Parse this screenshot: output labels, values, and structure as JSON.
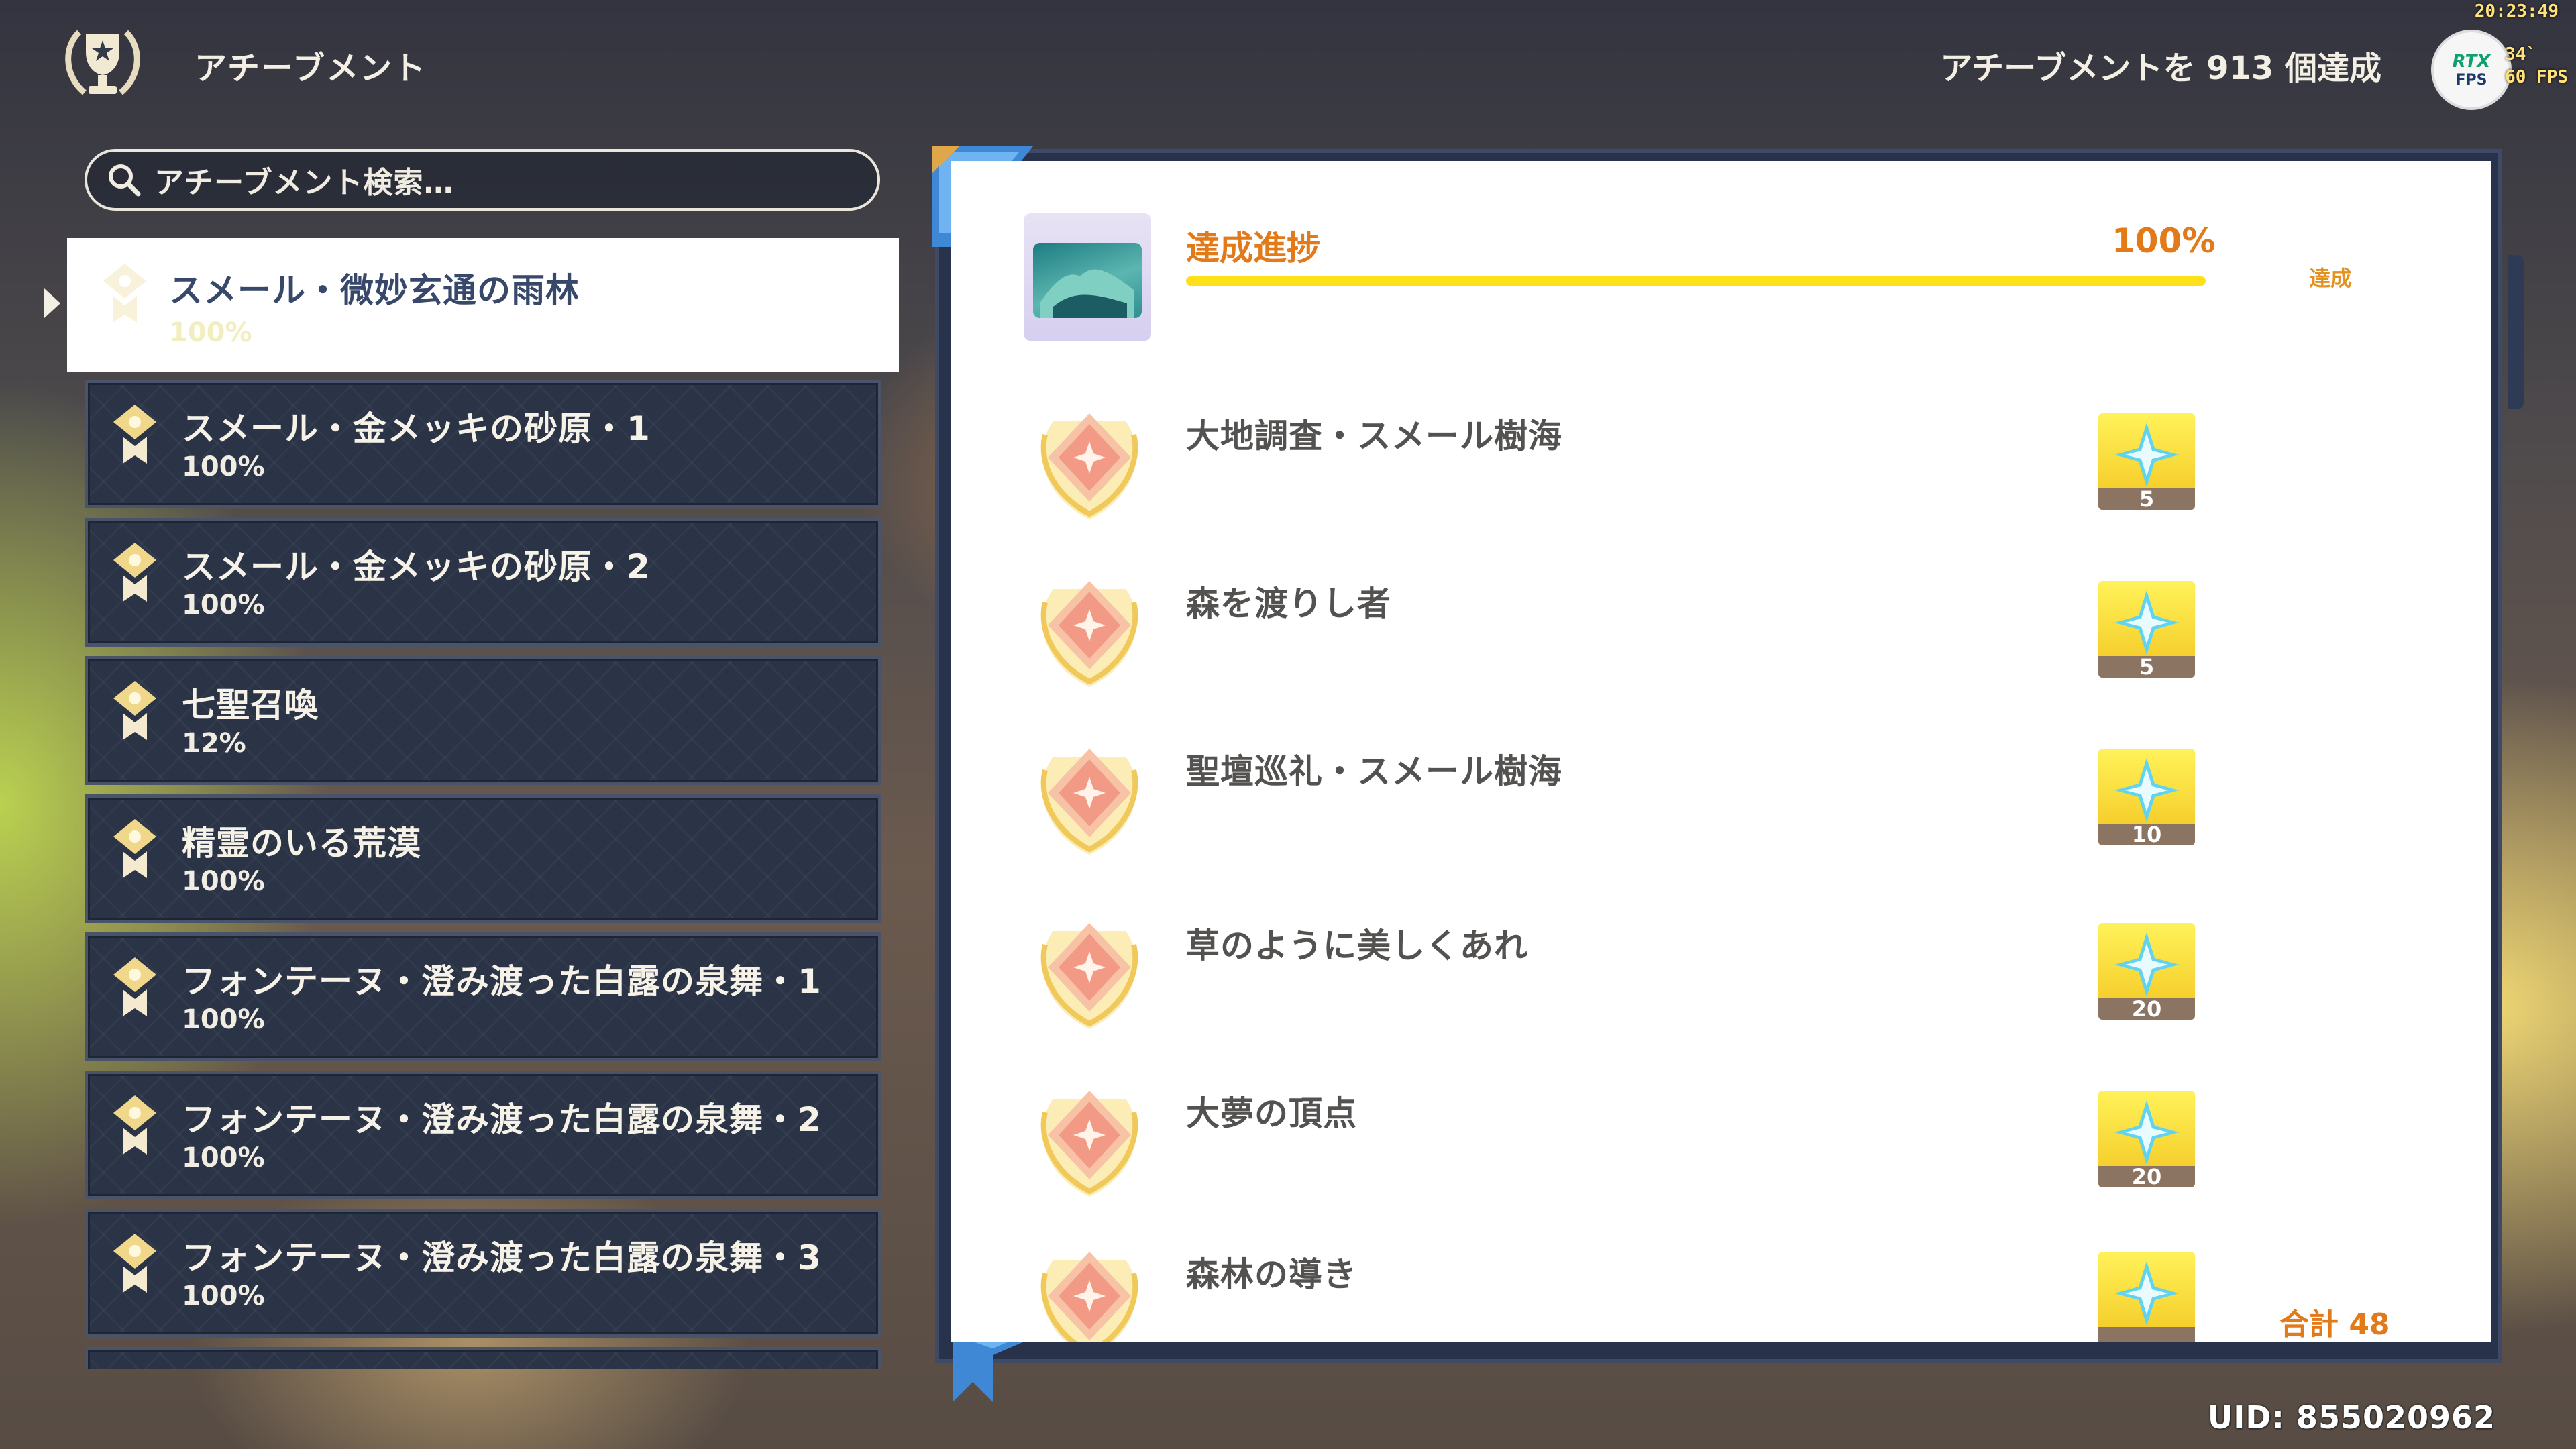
{
  "clock": "20:23:49",
  "perf": {
    "line1": "34`",
    "line2": "60 FPS"
  },
  "header": {
    "title": "アチーブメント",
    "logo_icon": "trophy-laurel-icon",
    "count_text": "アチーブメントを 913 個達成",
    "badge": {
      "top": "RTX",
      "bottom": "FPS"
    }
  },
  "search": {
    "placeholder": "アチーブメント検索…",
    "icon": "search-icon"
  },
  "categories": [
    {
      "name": "スメール・微妙玄通の雨林",
      "percent": "100%",
      "active": true
    },
    {
      "name": "スメール・金メッキの砂原・1",
      "percent": "100%"
    },
    {
      "name": "スメール・金メッキの砂原・2",
      "percent": "100%"
    },
    {
      "name": "七聖召喚",
      "percent": "12%"
    },
    {
      "name": "精霊のいる荒漠",
      "percent": "100%"
    },
    {
      "name": "フォンテーヌ・澄み渡った白露の泉舞・1",
      "percent": "100%"
    },
    {
      "name": "フォンテーヌ・澄み渡った白露の泉舞・2",
      "percent": "100%"
    },
    {
      "name": "フォンテーヌ・澄み渡った白露の泉舞・3",
      "percent": "100%"
    }
  ],
  "progress": {
    "label": "達成進捗",
    "value": "100%",
    "fraction": 1.0,
    "status": "達成"
  },
  "achievements": [
    {
      "title": "大地調査・スメール樹海",
      "reward": "5"
    },
    {
      "title": "森を渡りし者",
      "reward": "5"
    },
    {
      "title": "聖壇巡礼・スメール樹海",
      "reward": "10"
    },
    {
      "title": "草のように美しくあれ",
      "reward": "20"
    },
    {
      "title": "大夢の頂点",
      "reward": "20"
    },
    {
      "title": "森林の導き",
      "reward": ""
    }
  ],
  "total_label": "合計 48",
  "uid": "UID: 855020962",
  "colors": {
    "accent_orange": "#e27a1a",
    "progress_yellow": "#ffe11a",
    "panel_frame": "#28324a"
  }
}
